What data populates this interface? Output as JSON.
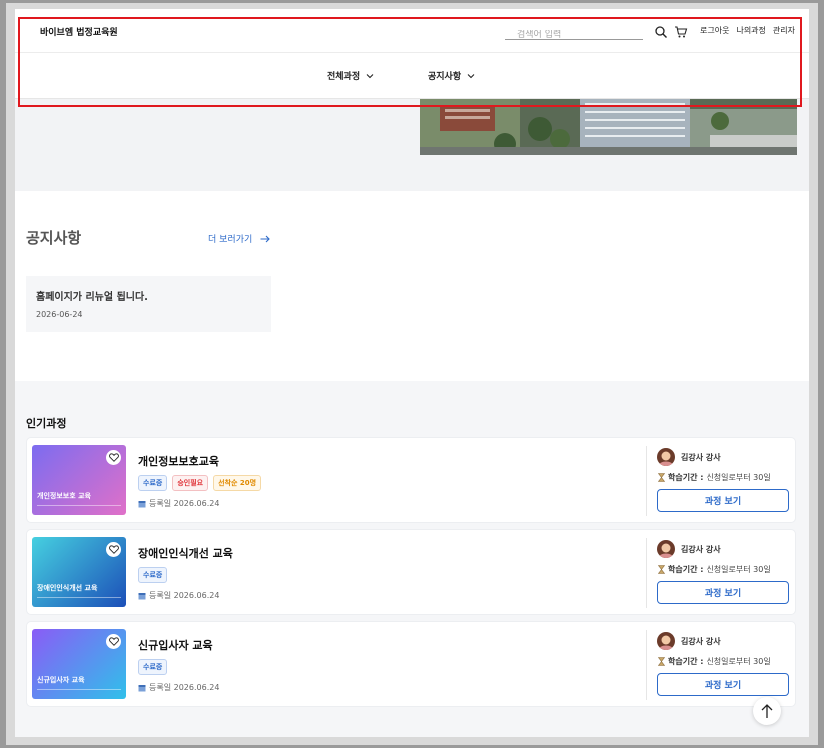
{
  "header": {
    "logo": "바이브엠 법정교육원",
    "search_placeholder": "검색어 입력",
    "links": {
      "logout": "로그아웃",
      "my_courses": "나의과정",
      "admin": "관리자"
    }
  },
  "nav": {
    "all_courses": "전체과정",
    "notices": "공지사항"
  },
  "notice": {
    "title": "공지사항",
    "more": "더 보러가기",
    "items": [
      {
        "title": "홈페이지가 리뉴얼 됩니다.",
        "date": "2026-06-24"
      }
    ]
  },
  "popular": {
    "title": "인기과정",
    "courses": [
      {
        "thumb_label": "개인정보보호 교육",
        "title": "개인정보보호교육",
        "tags": [
          "수료증",
          "승인필요",
          "선착순 20명"
        ],
        "registered": "등록일 2026.06.24",
        "instructor": "김강사 강사",
        "period_label": "학습기간 :",
        "period_value": "신청일로부터 30일",
        "button": "과정 보기",
        "gradient": [
          "#7c6cf0",
          "#e070c8"
        ]
      },
      {
        "thumb_label": "장애인인식개선 교육",
        "title": "장애인인식개선 교육",
        "tags": [
          "수료증"
        ],
        "registered": "등록일 2026.06.24",
        "instructor": "김강사 강사",
        "period_label": "학습기간 :",
        "period_value": "신청일로부터 30일",
        "button": "과정 보기",
        "gradient": [
          "#46d0e0",
          "#1c4fb8"
        ]
      },
      {
        "thumb_label": "신규입사자 교육",
        "title": "신규입사자 교육",
        "tags": [
          "수료증"
        ],
        "registered": "등록일 2026.06.24",
        "instructor": "김강사 강사",
        "period_label": "학습기간 :",
        "period_value": "신청일로부터 30일",
        "button": "과정 보기",
        "gradient": [
          "#8a5cf6",
          "#30c0ea"
        ]
      }
    ]
  },
  "colors": {
    "accent": "#2d6ac9",
    "highlight": "#e0181e"
  }
}
